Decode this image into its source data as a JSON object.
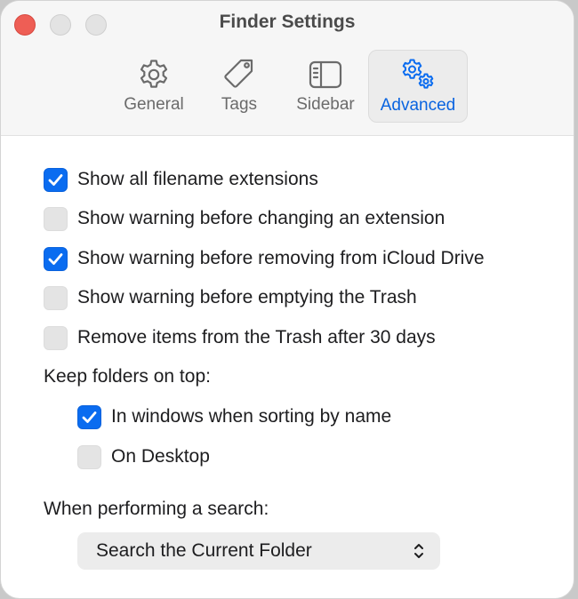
{
  "window": {
    "title": "Finder Settings"
  },
  "tabs": [
    {
      "label": "General",
      "icon": "gear-icon",
      "active": false
    },
    {
      "label": "Tags",
      "icon": "tag-icon",
      "active": false
    },
    {
      "label": "Sidebar",
      "icon": "sidebar-icon",
      "active": false
    },
    {
      "label": "Advanced",
      "icon": "gears-icon",
      "active": true
    }
  ],
  "options": [
    {
      "label": "Show all filename extensions",
      "checked": true
    },
    {
      "label": "Show warning before changing an extension",
      "checked": false
    },
    {
      "label": "Show warning before removing from iCloud Drive",
      "checked": true
    },
    {
      "label": "Show warning before emptying the Trash",
      "checked": false
    },
    {
      "label": "Remove items from the Trash after 30 days",
      "checked": false
    }
  ],
  "folders": {
    "heading": "Keep folders on top:",
    "options": [
      {
        "label": "In windows when sorting by name",
        "checked": true
      },
      {
        "label": "On Desktop",
        "checked": false
      }
    ]
  },
  "search": {
    "heading": "When performing a search:",
    "selected": "Search the Current Folder"
  },
  "colors": {
    "accent": "#0a6cf0",
    "close": "#ee5e55",
    "active_tab_text": "#0a64e0"
  }
}
